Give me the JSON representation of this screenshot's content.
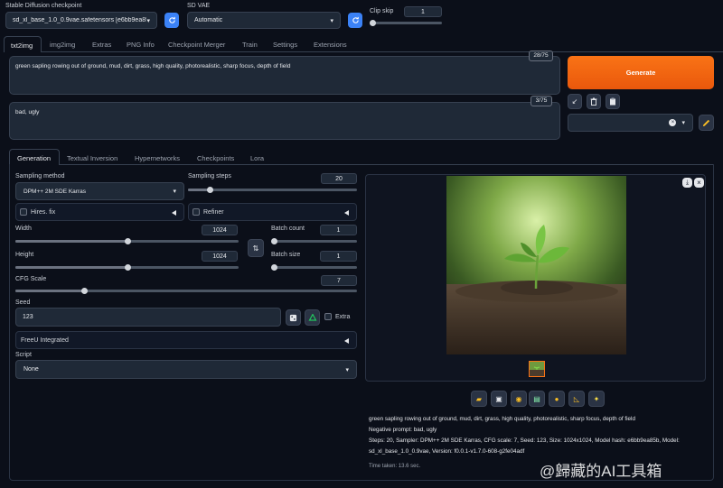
{
  "top": {
    "checkpoint_label": "Stable Diffusion checkpoint",
    "checkpoint_value": "sd_xl_base_1.0_0.9vae.safetensors [e6bb9ea85",
    "vae_label": "SD VAE",
    "vae_value": "Automatic",
    "clipskip_label": "Clip skip",
    "clipskip_value": "1"
  },
  "main_tabs": [
    "txt2img",
    "img2img",
    "Extras",
    "PNG Info",
    "Checkpoint Merger",
    "Train",
    "Settings",
    "Extensions"
  ],
  "prompt": {
    "text": "green sapling rowing out of ground, mud, dirt, grass, high quality, photorealistic, sharp focus, depth of field",
    "counter": "28/75"
  },
  "negative": {
    "text": "bad, ugly",
    "counter": "3/75"
  },
  "generate_label": "Generate",
  "sub_tabs": [
    "Generation",
    "Textual Inversion",
    "Hypernetworks",
    "Checkpoints",
    "Lora"
  ],
  "gen": {
    "sampling_method_label": "Sampling method",
    "sampling_method_value": "DPM++ 2M SDE Karras",
    "sampling_steps_label": "Sampling steps",
    "sampling_steps_value": "20",
    "sampling_steps_fraction": 0.13,
    "hires_label": "Hires. fix",
    "refiner_label": "Refiner",
    "width_label": "Width",
    "width_value": "1024",
    "width_fraction": 0.5,
    "height_label": "Height",
    "height_value": "1024",
    "height_fraction": 0.5,
    "batch_count_label": "Batch count",
    "batch_count_value": "1",
    "batch_size_label": "Batch size",
    "batch_size_value": "1",
    "cfg_label": "CFG Scale",
    "cfg_value": "7",
    "cfg_fraction": 0.2,
    "seed_label": "Seed",
    "seed_value": "123",
    "extra_label": "Extra",
    "freeu_label": "FreeU Integrated",
    "script_label": "Script",
    "script_value": "None",
    "swap_label": "⇅"
  },
  "output": {
    "info_prompt": "green sapling rowing out of ground, mud, dirt, grass, high quality, photorealistic, sharp focus, depth of field",
    "info_negative": "Negative prompt: bad, ugly",
    "info_params": "Steps: 20, Sampler: DPM++ 2M SDE Karras, CFG scale: 7, Seed: 123, Size: 1024x1024, Model hash: e6bb9ea85b, Model:",
    "info_model": "sd_xl_base_1.0_0.9vae, Version: f0.0.1-v1.7.0-608-g2fe04adf",
    "time_taken": "Time taken: 13.6 sec."
  },
  "watermark": "@歸藏的AI工具箱",
  "colors": {
    "background": "#0b0f19",
    "generate": "#f97316",
    "accent_blue": "#3b82f6"
  }
}
